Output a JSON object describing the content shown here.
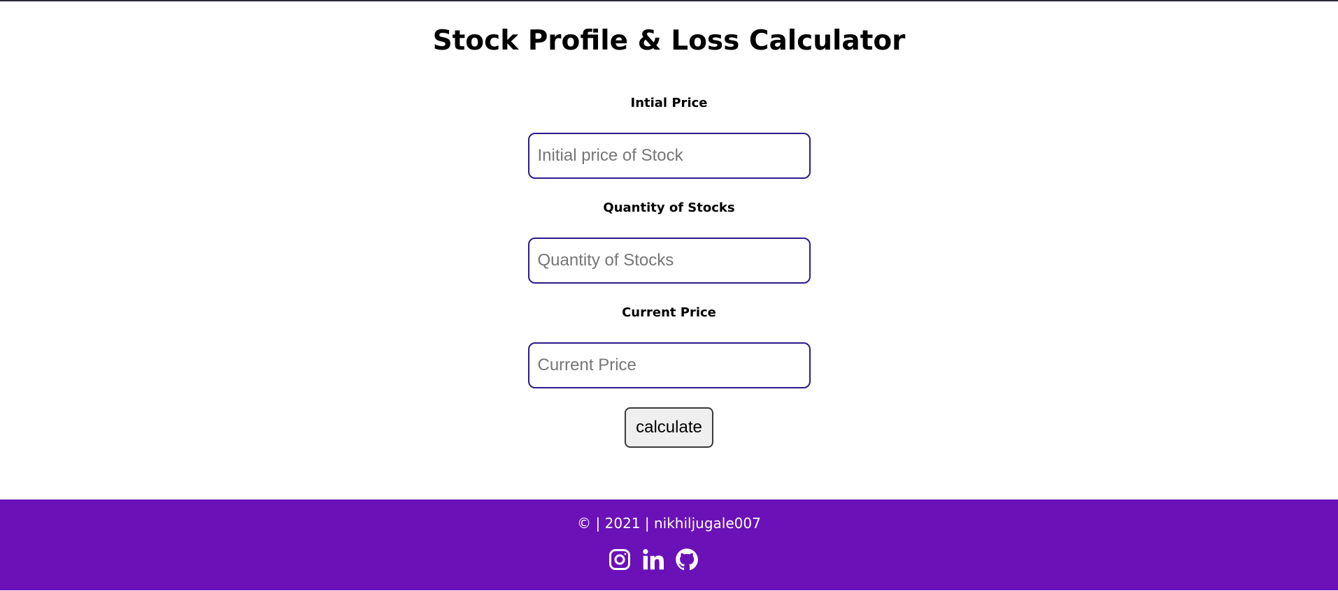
{
  "header": {
    "title": "Stock Profile & Loss Calculator"
  },
  "form": {
    "initial_price": {
      "label": "Intial Price",
      "placeholder": "Initial price of Stock",
      "value": ""
    },
    "quantity": {
      "label": "Quantity of Stocks",
      "placeholder": "Quantity of Stocks",
      "value": ""
    },
    "current_price": {
      "label": "Current Price",
      "placeholder": "Current Price",
      "value": ""
    },
    "calculate_label": "calculate"
  },
  "footer": {
    "copyright": "© | 2021 | nikhiljugale007",
    "background_color": "#6a11b8",
    "social_icons": [
      "instagram-icon",
      "linkedin-icon",
      "github-icon"
    ]
  },
  "colors": {
    "input_border": "#2d1a8c",
    "footer_bg": "#6a11b8"
  }
}
